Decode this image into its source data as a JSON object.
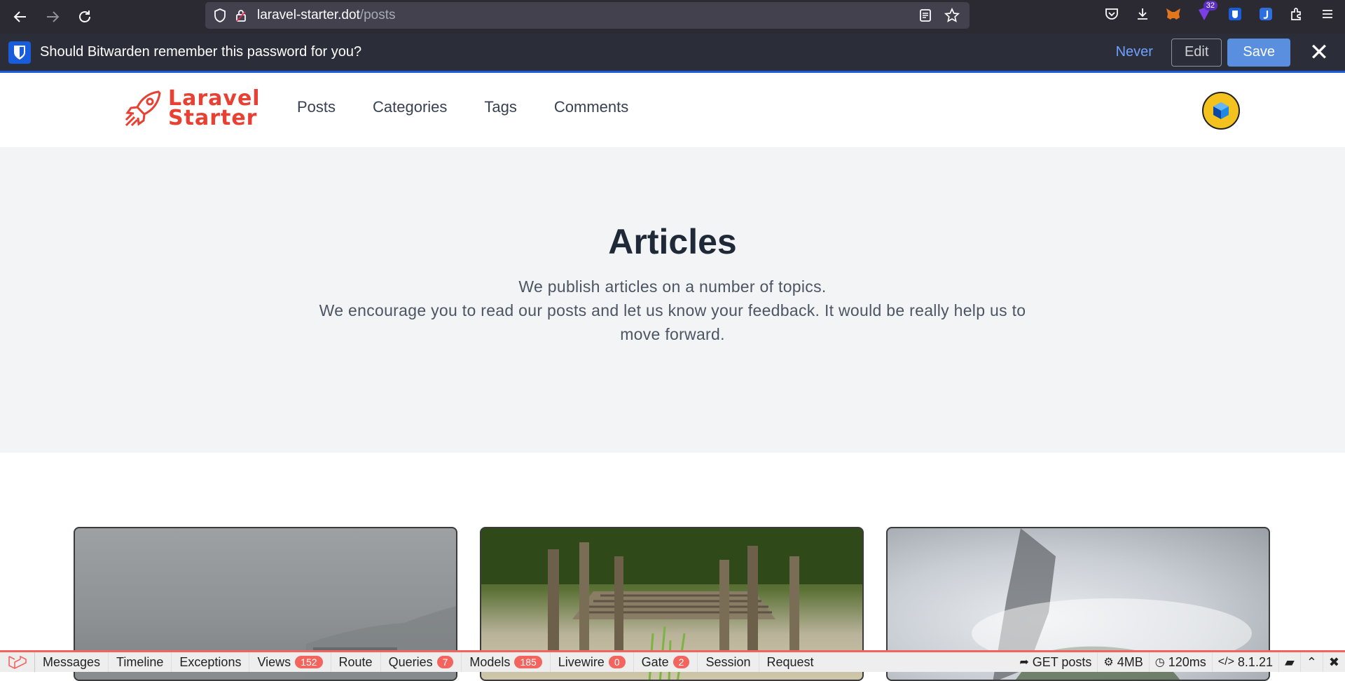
{
  "browser": {
    "url_host": "laravel-starter.dot",
    "url_path": "/posts",
    "extension_badge": "32"
  },
  "bitwarden": {
    "prompt": "Should Bitwarden remember this password for you?",
    "never_label": "Never",
    "edit_label": "Edit",
    "save_label": "Save"
  },
  "site": {
    "brand_line1": "Laravel",
    "brand_line2": "Starter",
    "nav": [
      "Posts",
      "Categories",
      "Tags",
      "Comments"
    ]
  },
  "hero": {
    "title": "Articles",
    "line1": "We publish articles on a number of topics.",
    "line2": "We encourage you to read our posts and let us know your feedback. It would be really help us to move forward."
  },
  "debugbar": {
    "tabs": [
      {
        "label": "Messages"
      },
      {
        "label": "Timeline"
      },
      {
        "label": "Exceptions"
      },
      {
        "label": "Views",
        "badge": "152"
      },
      {
        "label": "Route"
      },
      {
        "label": "Queries",
        "badge": "7"
      },
      {
        "label": "Models",
        "badge": "185"
      },
      {
        "label": "Livewire",
        "badge": "0"
      },
      {
        "label": "Gate",
        "badge": "2"
      },
      {
        "label": "Session"
      },
      {
        "label": "Request"
      }
    ],
    "request": "GET posts",
    "memory": "4MB",
    "time": "120ms",
    "php_version": "8.1.21"
  },
  "colors": {
    "brand_red": "#e84133",
    "bitwarden_blue": "#175ddc",
    "debug_red": "#f4645f"
  }
}
